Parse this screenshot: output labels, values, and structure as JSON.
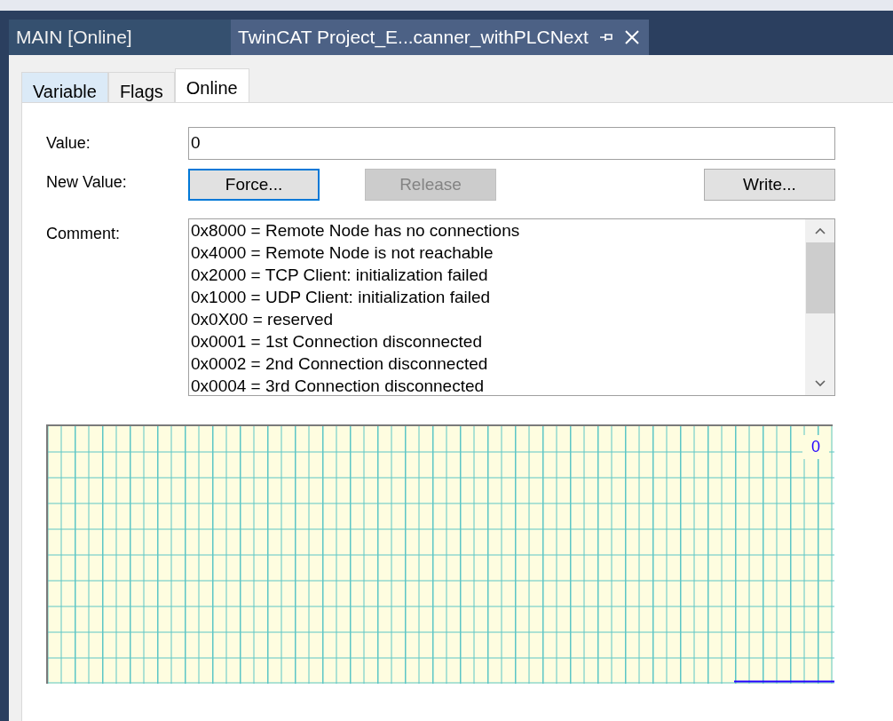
{
  "document_tabs": [
    {
      "label": "MAIN [Online]",
      "selected": false
    },
    {
      "label": "TwinCAT Project_E...canner_withPLCNext",
      "selected": true
    }
  ],
  "tabs": [
    {
      "label": "Variable",
      "selected": false,
      "hovered": true
    },
    {
      "label": "Flags",
      "selected": false,
      "hovered": false
    },
    {
      "label": "Online",
      "selected": true,
      "hovered": false
    }
  ],
  "value": {
    "label": "Value:",
    "value": "0"
  },
  "new_value": {
    "label": "New Value:",
    "buttons": [
      {
        "label": "Force...",
        "disabled": false,
        "focused": true
      },
      {
        "label": "Release",
        "disabled": true,
        "focused": false
      },
      {
        "label": "Write...",
        "disabled": false,
        "focused": false
      }
    ]
  },
  "comment": {
    "label": "Comment:",
    "lines": [
      "0x8000 = Remote Node has no connections",
      "0x4000 = Remote Node is not reachable",
      "0x2000 = TCP Client: initialization failed",
      "0x1000 = UDP Client: initialization failed",
      "0x0X00 = reserved",
      "0x0001 = 1st Connection disconnected",
      "0x0002 = 2nd Connection disconnected",
      "0x0004 = 3rd Connection disconnected"
    ]
  },
  "trend": {
    "value_label": "0"
  }
}
